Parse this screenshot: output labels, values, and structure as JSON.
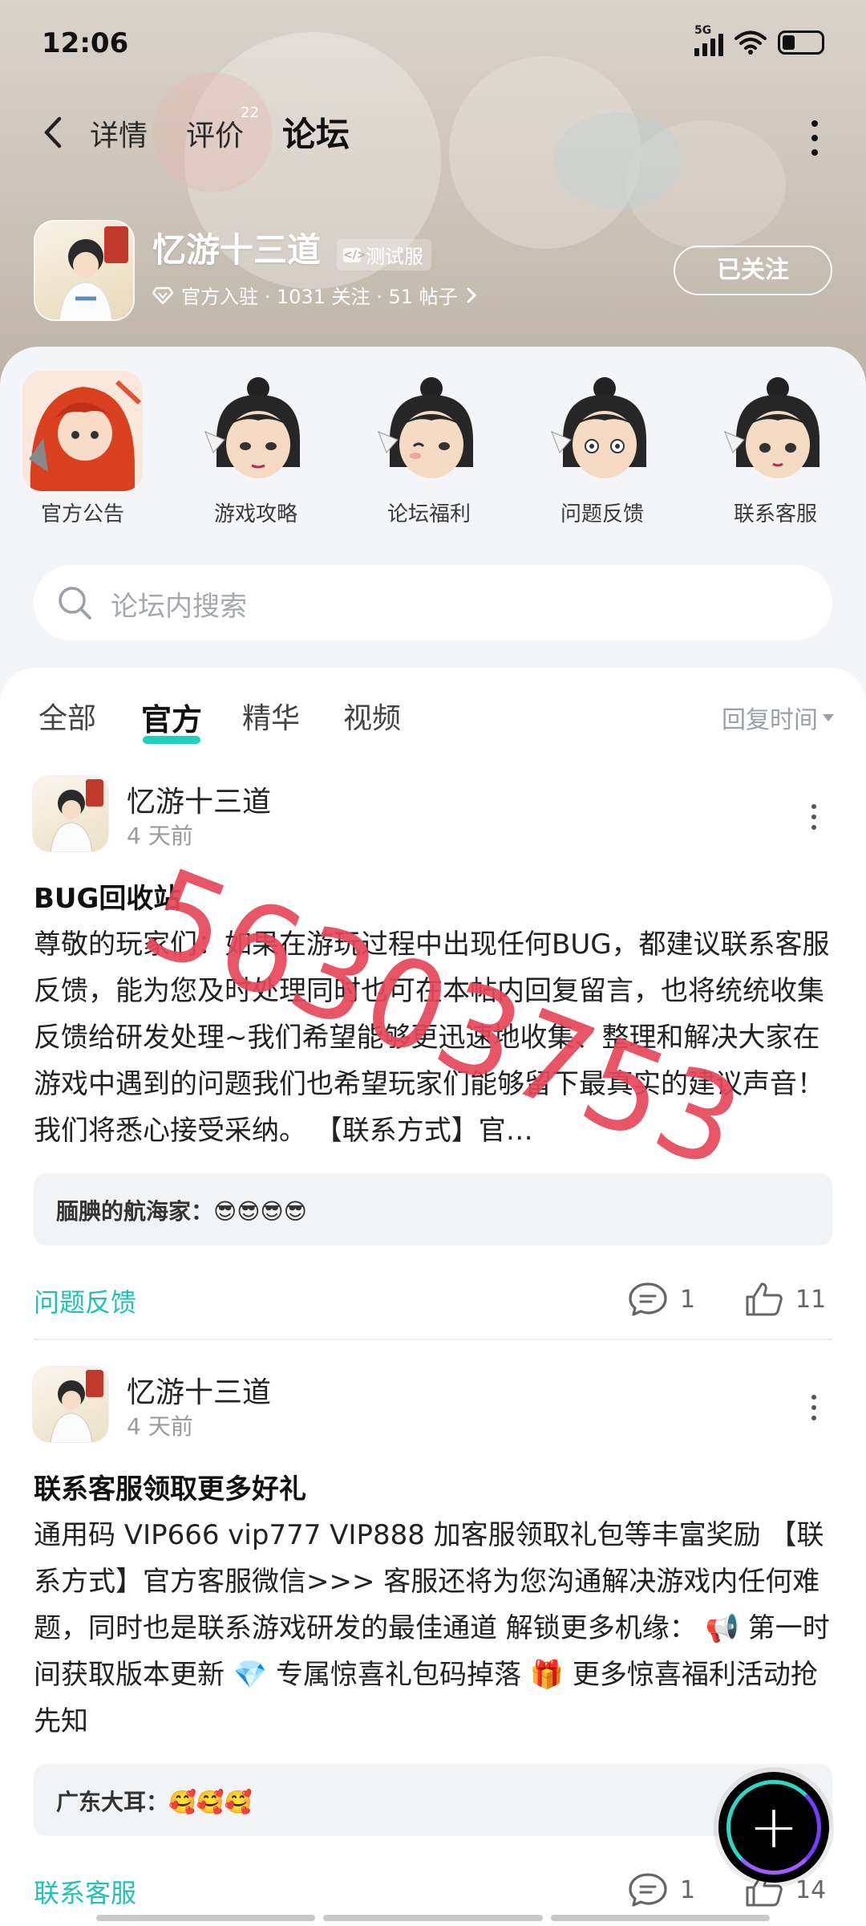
{
  "status_bar": {
    "time": "12:06",
    "network": "5G"
  },
  "nav": {
    "tabs": [
      {
        "label": "详情"
      },
      {
        "label": "评价",
        "badge": "22"
      },
      {
        "label": "论坛",
        "active": true
      }
    ]
  },
  "game": {
    "name": "忆游十三道",
    "tag": "测试服",
    "meta": "官方入驻 · 1031 关注 · 51 帖子",
    "follow_label": "已关注"
  },
  "shortcuts": [
    {
      "label": "官方公告"
    },
    {
      "label": "游戏攻略"
    },
    {
      "label": "论坛福利"
    },
    {
      "label": "问题反馈"
    },
    {
      "label": "联系客服"
    }
  ],
  "search": {
    "placeholder": "论坛内搜索"
  },
  "feed_tabs": [
    {
      "label": "全部"
    },
    {
      "label": "官方",
      "active": true
    },
    {
      "label": "精华"
    },
    {
      "label": "视频"
    }
  ],
  "sort_label": "回复时间",
  "posts": [
    {
      "author": "忆游十三道",
      "time": "4 天前",
      "title": "BUG回收站",
      "body": "尊敬的玩家们：如果在游玩过程中出现任何BUG，都建议联系客服反馈，能为您及时处理同时也可在本帖内回复留言，也将统统收集反馈给研发处理~我们希望能够更迅速地收集、整理和解决大家在游戏中遇到的问题我们也希望玩家们能够留下最真实的建议声音！我们将悉心接受采纳。 【联系方式】官…",
      "reply_name": "腼腆的航海家：",
      "reply_text": "😎😎😎😎",
      "topic": "问题反馈",
      "comments": "1",
      "likes": "11"
    },
    {
      "author": "忆游十三道",
      "time": "4 天前",
      "title": "联系客服领取更多好礼",
      "body": "通用码 VIP666 vip777 VIP888 加客服领取礼包等丰富奖励 【联系方式】官方客服微信>>> 客服还将为您沟通解决游戏内任何难题，同时也是联系游戏研发的最佳通道 解锁更多机缘： 📢 第一时间获取版本更新 💎 专属惊喜礼包码掉落 🎁 更多惊喜福利活动抢先知",
      "reply_name": "广东大耳：",
      "reply_text": "🥰🥰🥰",
      "topic": "联系客服",
      "comments": "1",
      "likes": "14"
    }
  ],
  "watermark": "56303753",
  "colors": {
    "accent": "#1fd0c0",
    "watermark": "#e5475a"
  }
}
